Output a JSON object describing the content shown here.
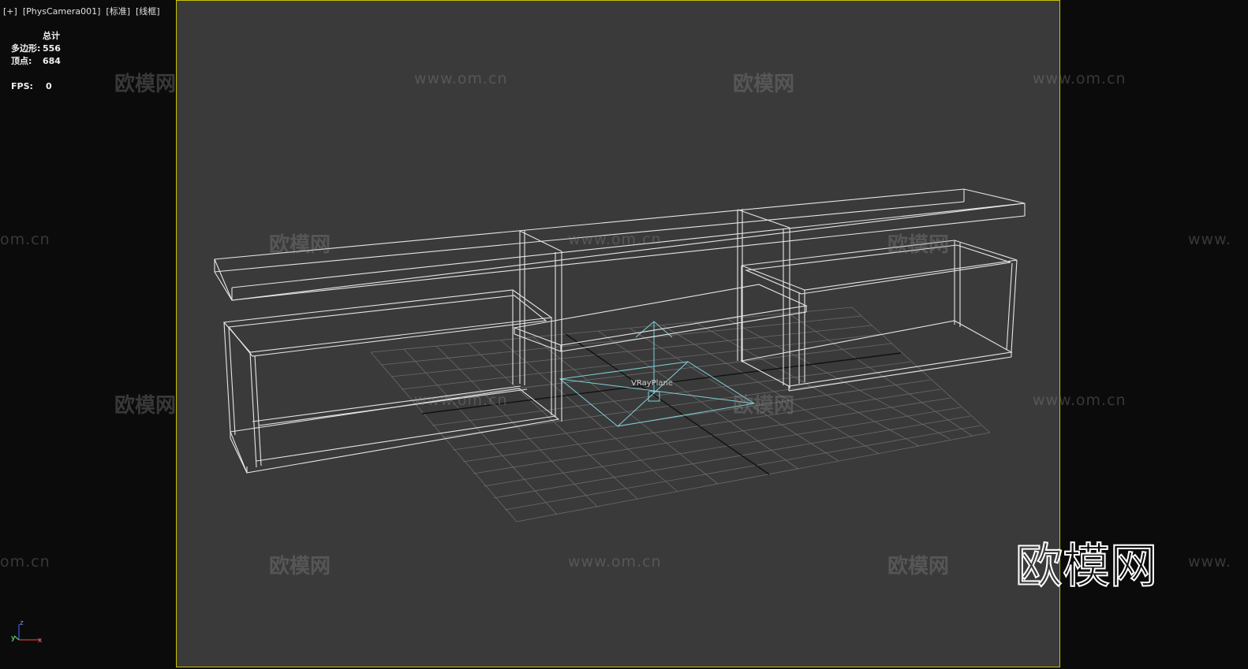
{
  "viewport": {
    "plus": "[+]",
    "camera": "[PhysCamera001]",
    "shading": "[标准]",
    "mode": "[线框]"
  },
  "stats": {
    "header": "总计",
    "polys_label": "多边形:",
    "polys_value": "556",
    "verts_label": "顶点:",
    "verts_value": "684",
    "fps_label": "FPS:",
    "fps_value": "0"
  },
  "object_label": "VRayPlane",
  "gizmo": {
    "z": "z",
    "x": "x",
    "y": "y"
  },
  "watermarks": {
    "logo": "欧模网",
    "url": "www.om.cn",
    "url_partial_left": "om.cn",
    "url_partial_right": "www."
  },
  "colors": {
    "frame_border": "#c8c400",
    "viewport_bg": "#3a3a3a",
    "wire": "#e6e6e6",
    "plane": "#7fd0d8"
  }
}
